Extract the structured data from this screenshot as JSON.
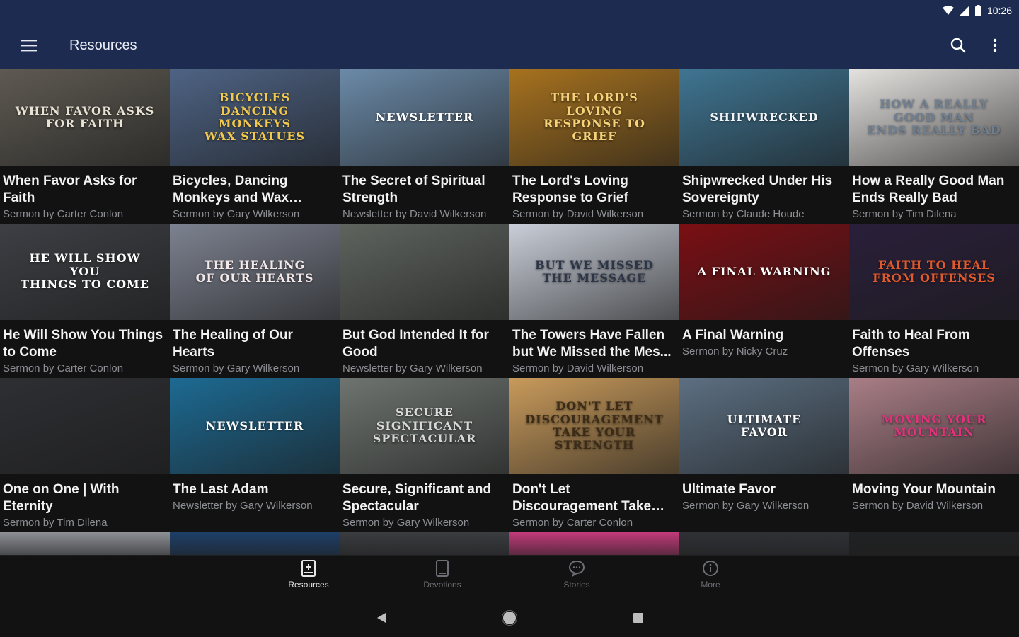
{
  "status": {
    "time": "10:26"
  },
  "app_bar": {
    "title": "Resources"
  },
  "colors": {
    "app_bar": "#1d2b50",
    "background": "#121212",
    "subtitle": "#8d8f94"
  },
  "cards": [
    {
      "title": "When Favor Asks for Faith",
      "subtitle": "Sermon by Carter Conlon",
      "thumb_text": "WHEN FAVOR ASKS\nFOR FAITH",
      "thumb_color": "#5e5a52",
      "thumb_fg": "#e8e2d4"
    },
    {
      "title": "Bicycles, Dancing Monkeys and Wax Statu...",
      "subtitle": "Sermon by Gary Wilkerson",
      "thumb_text": "BICYCLES\nDANCING MONKEYS\nWAX STATUES",
      "thumb_color": "#4e6384",
      "thumb_fg": "#f2c94c"
    },
    {
      "title": "The Secret of Spiritual Strength",
      "subtitle": "Newsletter by David Wilkerson",
      "thumb_text": "NEWSLETTER",
      "thumb_color": "#6b8aa8",
      "thumb_fg": "#ffffff"
    },
    {
      "title": "The Lord's Loving Response to Grief",
      "subtitle": "Sermon by David Wilkerson",
      "thumb_text": "THE LORD'S LOVING\nRESPONSE TO GRIEF",
      "thumb_color": "#a7721f",
      "thumb_fg": "#f5d27a"
    },
    {
      "title": "Shipwrecked Under His Sovereignty",
      "subtitle": "Sermon by Claude Houde",
      "thumb_text": "SHIPWRECKED",
      "thumb_color": "#3f7592",
      "thumb_fg": "#f0f4f8"
    },
    {
      "title": "How a Really Good Man Ends Really Bad",
      "subtitle": "Sermon by Tim Dilena",
      "thumb_text": "HOW A REALLY\nGOOD MAN\nENDS REALLY BAD",
      "thumb_color": "#e4e2df",
      "thumb_fg": "#6f7f92"
    },
    {
      "title": "He Will Show You Things to Come",
      "subtitle": "Sermon by Carter Conlon",
      "thumb_text": "HE WILL SHOW YOU\nTHINGS TO COME",
      "thumb_color": "#3d3f44",
      "thumb_fg": "#ffffff"
    },
    {
      "title": "The Healing of Our Hearts",
      "subtitle": "Sermon by Gary Wilkerson",
      "thumb_text": "THE HEALING\nOF OUR HEARTS",
      "thumb_color": "#7d8290",
      "thumb_fg": "#f3e9ea"
    },
    {
      "title": "But God Intended It for Good",
      "subtitle": "Newsletter by Gary Wilkerson",
      "thumb_text": "",
      "thumb_color": "#5f645f",
      "thumb_fg": "#ffffff"
    },
    {
      "title": "The Towers Have Fallen but We Missed the Mes...",
      "subtitle": "Sermon by David Wilkerson",
      "thumb_text": "BUT WE MISSED\nTHE MESSAGE",
      "thumb_color": "#c9ced8",
      "thumb_fg": "#2c3547"
    },
    {
      "title": "A Final Warning",
      "subtitle": "Sermon by Nicky Cruz",
      "thumb_text": "A FINAL WARNING",
      "thumb_color": "#7a0f14",
      "thumb_fg": "#ffffff"
    },
    {
      "title": "Faith to Heal From Offenses",
      "subtitle": "Sermon by Gary Wilkerson",
      "thumb_text": "FAITH TO HEAL FROM OFFENSES",
      "thumb_color": "#2a1f3a",
      "thumb_fg": "#e05a2e"
    },
    {
      "title": "One on One | With Eternity",
      "subtitle": "Sermon by Tim Dilena",
      "thumb_text": "",
      "thumb_color": "#2e2f33",
      "thumb_fg": "#ffffff"
    },
    {
      "title": "The Last Adam",
      "subtitle": "Newsletter by Gary Wilkerson",
      "thumb_text": "NEWSLETTER",
      "thumb_color": "#1d6a93",
      "thumb_fg": "#ffffff"
    },
    {
      "title": "Secure, Significant and Spectacular",
      "subtitle": "Sermon by Gary Wilkerson",
      "thumb_text": "SECURE SIGNIFICANT\nSPECTACULAR",
      "thumb_color": "#6e7470",
      "thumb_fg": "#d8d8d8"
    },
    {
      "title": "Don't Let Discouragement Take Your Strength",
      "subtitle": "Sermon by Carter Conlon",
      "thumb_text": "DON'T LET DISCOURAGEMENT\nTAKE YOUR STRENGTH",
      "thumb_color": "#c89a5b",
      "thumb_fg": "#3a2a16"
    },
    {
      "title": "Ultimate Favor",
      "subtitle": "Sermon by Gary Wilkerson",
      "thumb_text": "ULTIMATE\nFAVOR",
      "thumb_color": "#5c6f82",
      "thumb_fg": "#ffffff"
    },
    {
      "title": "Moving Your Mountain",
      "subtitle": "Sermon by David Wilkerson",
      "thumb_text": "MOVING YOUR\nMOUNTAIN",
      "thumb_color": "#a97e86",
      "thumb_fg": "#e1337d"
    }
  ],
  "partial_row_colors": [
    "#8d9096",
    "#1d3f68",
    "#3a3c40",
    "#c23a7a",
    "#2f3136",
    "#1f2122"
  ],
  "bottom_nav": [
    {
      "label": "Resources",
      "icon": "book-plus-icon",
      "active": true
    },
    {
      "label": "Devotions",
      "icon": "tablet-icon",
      "active": false
    },
    {
      "label": "Stories",
      "icon": "chat-bubble-icon",
      "active": false
    },
    {
      "label": "More",
      "icon": "info-icon",
      "active": false
    }
  ]
}
